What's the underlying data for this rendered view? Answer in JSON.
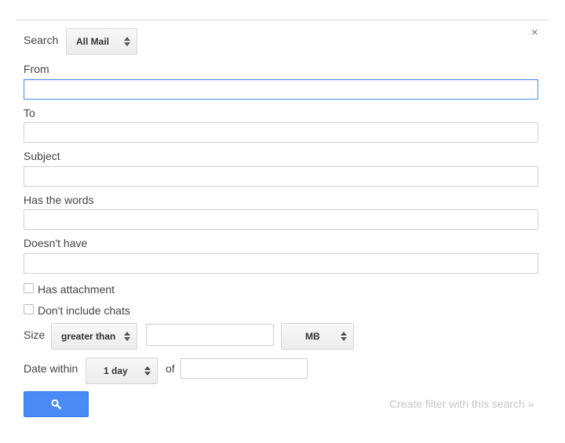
{
  "dialog": {
    "close_glyph": "×",
    "search_label": "Search",
    "search_scope": {
      "selected": "All Mail"
    }
  },
  "fields": {
    "from": {
      "label": "From",
      "value": ""
    },
    "to": {
      "label": "To",
      "value": ""
    },
    "subject": {
      "label": "Subject",
      "value": ""
    },
    "has_words": {
      "label": "Has the words",
      "value": ""
    },
    "doesnt_have": {
      "label": "Doesn't have",
      "value": ""
    }
  },
  "options": {
    "has_attachment": {
      "label": "Has attachment",
      "checked": false
    },
    "dont_include_chats": {
      "label": "Don't include chats",
      "checked": false
    }
  },
  "size": {
    "label": "Size",
    "operator": "greater than",
    "value": "",
    "unit": "MB"
  },
  "date": {
    "label": "Date within",
    "range": "1 day",
    "of_label": "of",
    "value": ""
  },
  "actions": {
    "search_icon": "search-icon",
    "create_filter": "Create filter with this search »"
  },
  "colors": {
    "primary_button": "#4a8af4",
    "focus_border": "#4d90fe",
    "link_disabled": "#c6c6c6"
  }
}
